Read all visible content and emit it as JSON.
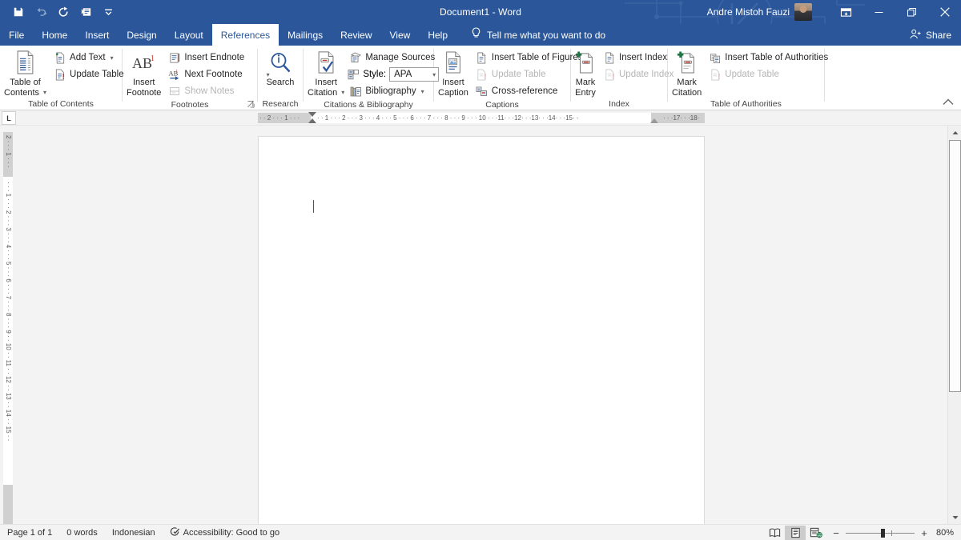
{
  "titlebar": {
    "quick_access": [
      {
        "name": "save-icon",
        "glyph": "💾",
        "enabled": true
      },
      {
        "name": "undo-icon",
        "glyph": "↶",
        "enabled": false
      },
      {
        "name": "redo-icon",
        "glyph": "↻",
        "enabled": true
      },
      {
        "name": "touch-mode-icon",
        "glyph": "❐",
        "enabled": true
      },
      {
        "name": "customize-qat-icon",
        "glyph": "⌄",
        "enabled": true
      }
    ],
    "document_title": "Document1  -  Word",
    "account_name": "Andre Mistoh Fauzi",
    "ribbon_display_options": "❐",
    "minimize": "—",
    "restore": "❐",
    "close": "✕"
  },
  "tabs": [
    {
      "label": "File",
      "active": false
    },
    {
      "label": "Home",
      "active": false
    },
    {
      "label": "Insert",
      "active": false
    },
    {
      "label": "Design",
      "active": false
    },
    {
      "label": "Layout",
      "active": false
    },
    {
      "label": "References",
      "active": true
    },
    {
      "label": "Mailings",
      "active": false
    },
    {
      "label": "Review",
      "active": false
    },
    {
      "label": "View",
      "active": false
    },
    {
      "label": "Help",
      "active": false
    }
  ],
  "tell_me": {
    "label": "Tell me what you want to do",
    "icon": "lightbulb-icon"
  },
  "share": {
    "label": "Share",
    "icon": "share-person-icon"
  },
  "ribbon": {
    "groups": [
      {
        "name": "table-of-contents",
        "label": "Table of Contents",
        "big_button": {
          "label_line1": "Table of",
          "label_line2": "Contents",
          "has_caret": true
        },
        "small_buttons": [
          {
            "label": "Add Text",
            "icon": "add-text-icon",
            "caret": true,
            "disabled": false
          },
          {
            "label": "Update Table",
            "icon": "update-table-icon",
            "caret": false,
            "disabled": false
          }
        ]
      },
      {
        "name": "footnotes",
        "label": "Footnotes",
        "dialog_launcher": true,
        "big_button": {
          "glyph": "AB",
          "sup": "1",
          "label_line1": "Insert",
          "label_line2": "Footnote",
          "has_caret": false
        },
        "small_buttons": [
          {
            "label": "Insert Endnote",
            "icon": "insert-endnote-icon",
            "caret": false,
            "disabled": false
          },
          {
            "label": "Next Footnote",
            "icon": "next-footnote-icon",
            "caret": true,
            "disabled": false
          },
          {
            "label": "Show Notes",
            "icon": "show-notes-icon",
            "caret": false,
            "disabled": true
          }
        ]
      },
      {
        "name": "research",
        "label": "Research",
        "big_button": {
          "label_line1": "Search",
          "label_line2": "",
          "has_caret": false
        }
      },
      {
        "name": "citations-bibliography",
        "label": "Citations & Bibliography",
        "big_button": {
          "label_line1": "Insert",
          "label_line2": "Citation",
          "has_caret": true
        },
        "small_buttons": [
          {
            "label": "Manage Sources",
            "icon": "manage-sources-icon",
            "caret": false,
            "disabled": false
          },
          {
            "label": "Bibliography",
            "icon": "bibliography-icon",
            "caret": true,
            "disabled": false
          }
        ],
        "style": {
          "label": "Style:",
          "value": "APA",
          "icon": "style-icon"
        }
      },
      {
        "name": "captions",
        "label": "Captions",
        "big_button": {
          "label_line1": "Insert",
          "label_line2": "Caption",
          "has_caret": false
        },
        "small_buttons": [
          {
            "label": "Insert Table of Figures",
            "icon": "insert-table-of-figures-icon",
            "caret": false,
            "disabled": false
          },
          {
            "label": "Update Table",
            "icon": "update-table-icon",
            "caret": false,
            "disabled": true
          },
          {
            "label": "Cross-reference",
            "icon": "cross-reference-icon",
            "caret": false,
            "disabled": false
          }
        ]
      },
      {
        "name": "index",
        "label": "Index",
        "big_button": {
          "label_line1": "Mark",
          "label_line2": "Entry",
          "has_caret": false
        },
        "small_buttons": [
          {
            "label": "Insert Index",
            "icon": "insert-index-icon",
            "caret": false,
            "disabled": false
          },
          {
            "label": "Update Index",
            "icon": "update-index-icon",
            "caret": false,
            "disabled": true
          }
        ]
      },
      {
        "name": "table-of-authorities",
        "label": "Table of Authorities",
        "big_button": {
          "label_line1": "Mark",
          "label_line2": "Citation",
          "has_caret": false
        },
        "small_buttons": [
          {
            "label": "Insert Table of Authorities",
            "icon": "insert-table-of-authorities-icon",
            "caret": false,
            "disabled": false
          },
          {
            "label": "Update Table",
            "icon": "update-table-icon",
            "caret": false,
            "disabled": true
          }
        ]
      }
    ],
    "collapse_icon": "∧"
  },
  "ruler": {
    "tab_stop_selector": "L",
    "horizontal_left_margin_marks": "· · 2 · · · 1 · · ·",
    "horizontal_marks": "· · 1 · · · 2 · · · 3 · · · 4 · · · 5 · · · 6 · · · 7 · · · 8 · · · 9 · · · 10 · · ·11· · ·12· · ·13· · ·14· · ·15· ·",
    "horizontal_right_margin_marks": "· · ·17· · ·18·",
    "vertical_top_marks": "2 · · · 1 · · ·",
    "vertical_marks": "· · · 1 · · · 2 · · · 3 · · · 4 · · · 5 · · · 6 · · · 7 · · · 8 · · · 9 · · 10 · · 11 · · 12 · · 13 · · 14 · · 15 · ·"
  },
  "document": {
    "page_number": 1,
    "content": ""
  },
  "statusbar": {
    "page_status": "Page 1 of 1",
    "word_count": "0 words",
    "language": "Indonesian",
    "accessibility": "Accessibility: Good to go",
    "accessibility_icon": "accessibility-check-icon",
    "views": [
      {
        "name": "read-mode-view-button",
        "glyph": "📖",
        "active": false
      },
      {
        "name": "print-layout-view-button",
        "glyph": "▤",
        "active": true
      },
      {
        "name": "web-layout-view-button",
        "glyph": "▥",
        "active": false
      }
    ],
    "zoom_out": "−",
    "zoom_in": "+",
    "zoom_level": "80%"
  },
  "colors": {
    "word_blue": "#2b579a",
    "ribbon_bg": "#ffffff",
    "app_bg": "#f3f3f3",
    "accent_green": "#217346",
    "accent_red": "#c0504d"
  }
}
